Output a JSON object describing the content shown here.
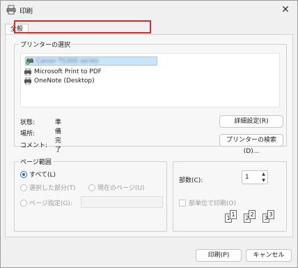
{
  "window": {
    "title": "印刷",
    "close_symbol": "✕"
  },
  "tab": {
    "label": "全般"
  },
  "printer_select": {
    "legend": "プリンターの選択",
    "printers": [
      {
        "name": "Canon TS300 series",
        "selected": true,
        "blurred": true
      },
      {
        "name": "Microsoft Print to PDF",
        "selected": false
      },
      {
        "name": "OneNote (Desktop)",
        "selected": false
      }
    ],
    "status_label": "状態:",
    "status_value": "準備完了",
    "location_label": "場所:",
    "location_value": "",
    "comment_label": "コメント:",
    "comment_value": "",
    "preferences_button": "詳細設定(R)",
    "find_printer_button": "プリンターの検索(D)..."
  },
  "page_range": {
    "legend": "ページ範囲",
    "all": "すべて(L)",
    "selection": "選択した部分(T)",
    "current_page": "現在のページ(U)",
    "pages": "ページ指定(G):",
    "pages_value": ""
  },
  "copies": {
    "label": "部数(C):",
    "value": "1",
    "collate_label": "部単位で印刷(O)",
    "collate_digits": [
      "1",
      "1",
      "2",
      "2",
      "3",
      "3"
    ]
  },
  "footer": {
    "print_button": "印刷(P)",
    "cancel_button": "キャンセル"
  },
  "colors": {
    "selection_outline": "#d42a2a",
    "accent": "#2a64b0"
  }
}
